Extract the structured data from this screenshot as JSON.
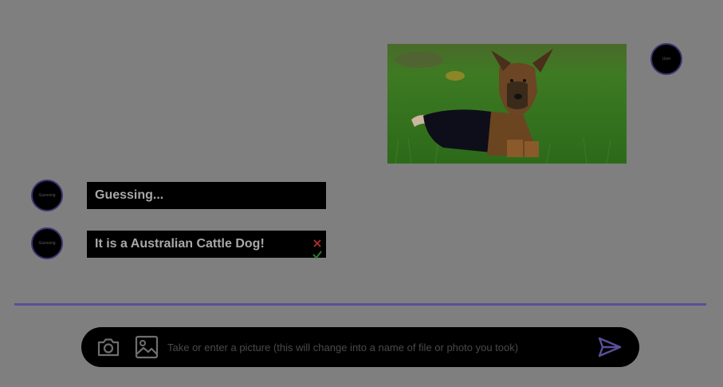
{
  "chat": {
    "user_message": {
      "avatar_label": "User",
      "image_subject": "dog-photo"
    },
    "bot_messages": [
      {
        "avatar_label": "Guessing",
        "text": "Guessing..."
      },
      {
        "avatar_label": "Guessing",
        "text": "It is a Australian Cattle Dog!"
      }
    ],
    "feedback": {
      "reject_icon": "close-icon",
      "accept_icon": "check-icon"
    }
  },
  "composer": {
    "input_placeholder": "Take or enter a picture (this will change into a name of file or photo you took)",
    "input_value": "",
    "camera_icon": "camera-icon",
    "gallery_icon": "image-icon",
    "send_icon": "send-icon"
  },
  "colors": {
    "background": "#7f7f7f",
    "accent": "#5b4f99",
    "bubble": "#000000",
    "reject": "#a12a2a",
    "accept": "#2f7a2f"
  }
}
